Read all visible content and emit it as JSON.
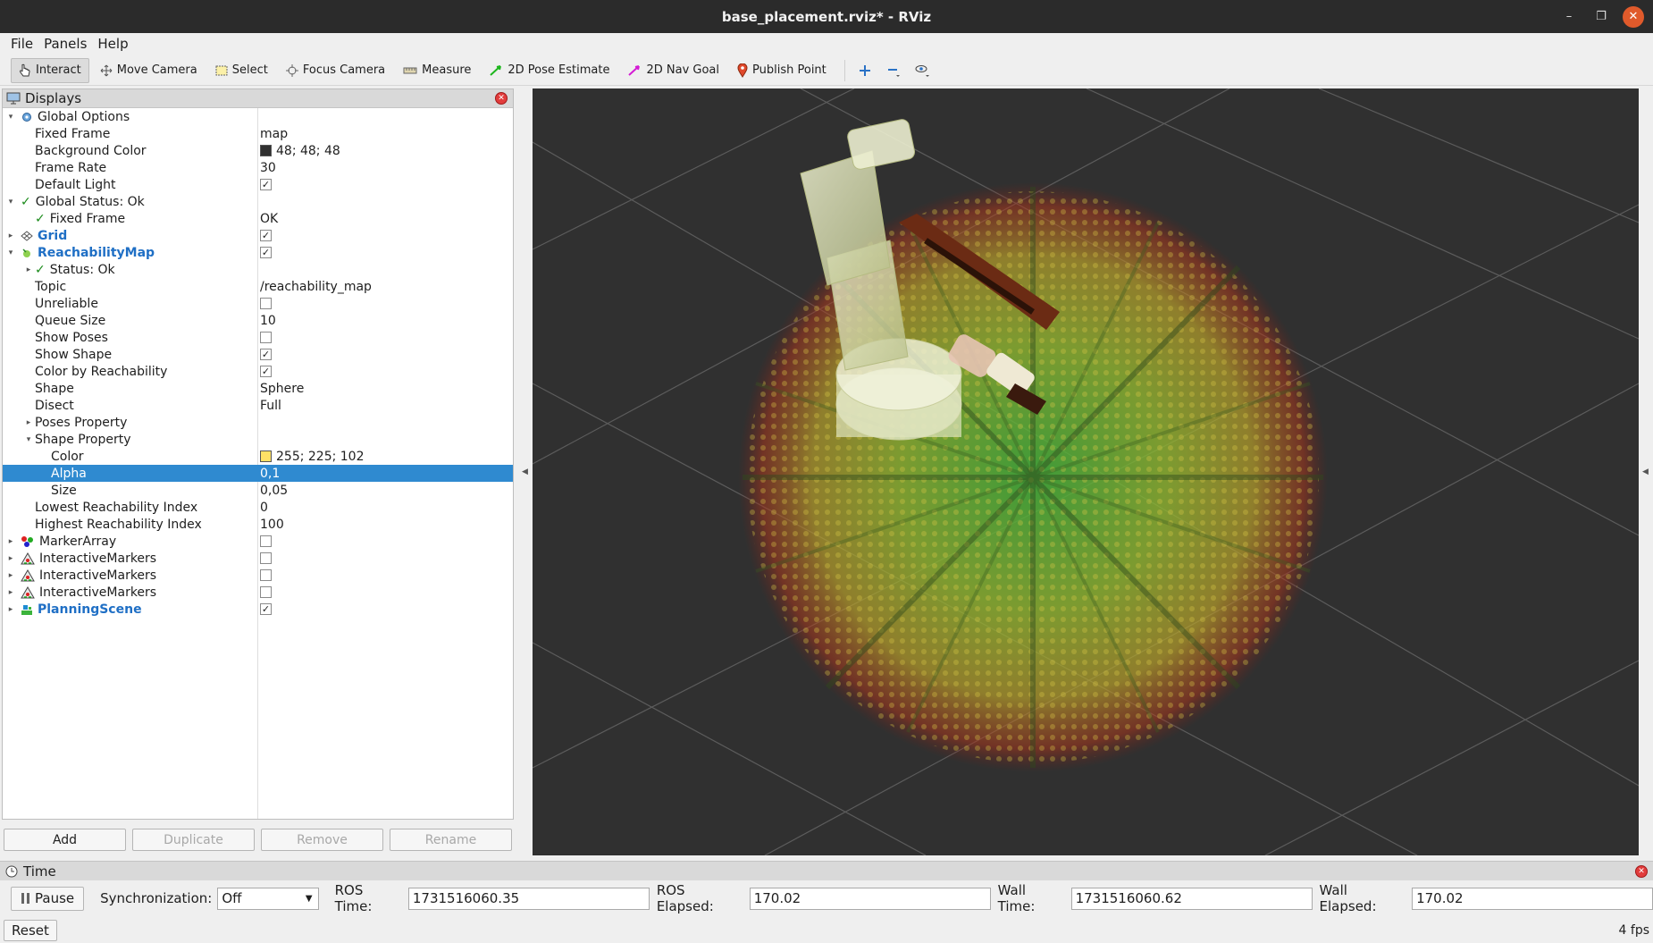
{
  "window": {
    "title": "base_placement.rviz* - RViz"
  },
  "menu": [
    "File",
    "Panels",
    "Help"
  ],
  "toolbar": {
    "interact": "Interact",
    "move_camera": "Move Camera",
    "select": "Select",
    "focus_camera": "Focus Camera",
    "measure": "Measure",
    "pose_estimate": "2D Pose Estimate",
    "nav_goal": "2D Nav Goal",
    "publish_point": "Publish Point"
  },
  "displays_panel": {
    "title": "Displays",
    "rows": {
      "global_options": "Global Options",
      "fixed_frame": {
        "label": "Fixed Frame",
        "value": "map"
      },
      "background_color": {
        "label": "Background Color",
        "value": "48; 48; 48",
        "swatch": "#303030"
      },
      "frame_rate": {
        "label": "Frame Rate",
        "value": "30"
      },
      "default_light": {
        "label": "Default Light",
        "checked": true
      },
      "global_status": "Global Status: Ok",
      "status_fixed_frame": {
        "label": "Fixed Frame",
        "value": "OK"
      },
      "grid": {
        "label": "Grid",
        "checked": true
      },
      "reachability_map": {
        "label": "ReachabilityMap",
        "checked": true
      },
      "status_ok": "Status: Ok",
      "topic": {
        "label": "Topic",
        "value": "/reachability_map"
      },
      "unreliable": {
        "label": "Unreliable",
        "checked": false
      },
      "queue_size": {
        "label": "Queue Size",
        "value": "10"
      },
      "show_poses": {
        "label": "Show Poses",
        "checked": false
      },
      "show_shape": {
        "label": "Show Shape",
        "checked": true
      },
      "color_by_reachability": {
        "label": "Color by Reachability",
        "checked": true
      },
      "shape": {
        "label": "Shape",
        "value": "Sphere"
      },
      "disect": {
        "label": "Disect",
        "value": "Full"
      },
      "poses_property": "Poses Property",
      "shape_property": "Shape Property",
      "color": {
        "label": "Color",
        "value": "255; 225; 102",
        "swatch": "#ffe166"
      },
      "alpha": {
        "label": "Alpha",
        "value": "0,1"
      },
      "size": {
        "label": "Size",
        "value": "0,05"
      },
      "lowest_index": {
        "label": "Lowest Reachability Index",
        "value": "0"
      },
      "highest_index": {
        "label": "Highest Reachability Index",
        "value": "100"
      },
      "marker_array": {
        "label": "MarkerArray",
        "checked": false
      },
      "interactive_markers_1": {
        "label": "InteractiveMarkers",
        "checked": false
      },
      "interactive_markers_2": {
        "label": "InteractiveMarkers",
        "checked": false
      },
      "interactive_markers_3": {
        "label": "InteractiveMarkers",
        "checked": false
      },
      "planning_scene": {
        "label": "PlanningScene",
        "checked": true
      }
    },
    "buttons": {
      "add": "Add",
      "duplicate": "Duplicate",
      "remove": "Remove",
      "rename": "Rename"
    }
  },
  "time_panel": {
    "title": "Time",
    "pause": "Pause",
    "sync_label": "Synchronization:",
    "sync_value": "Off",
    "ros_time_label": "ROS Time:",
    "ros_time": "1731516060.35",
    "ros_elapsed_label": "ROS Elapsed:",
    "ros_elapsed": "170.02",
    "wall_time_label": "Wall Time:",
    "wall_time": "1731516060.62",
    "wall_elapsed_label": "Wall Elapsed:",
    "wall_elapsed": "170.02"
  },
  "status": {
    "reset": "Reset",
    "fps": "4 fps"
  },
  "colors": {
    "viewport_bg": "#303030",
    "selection": "#2f8ad0",
    "link_blue": "#1f6fc5"
  }
}
